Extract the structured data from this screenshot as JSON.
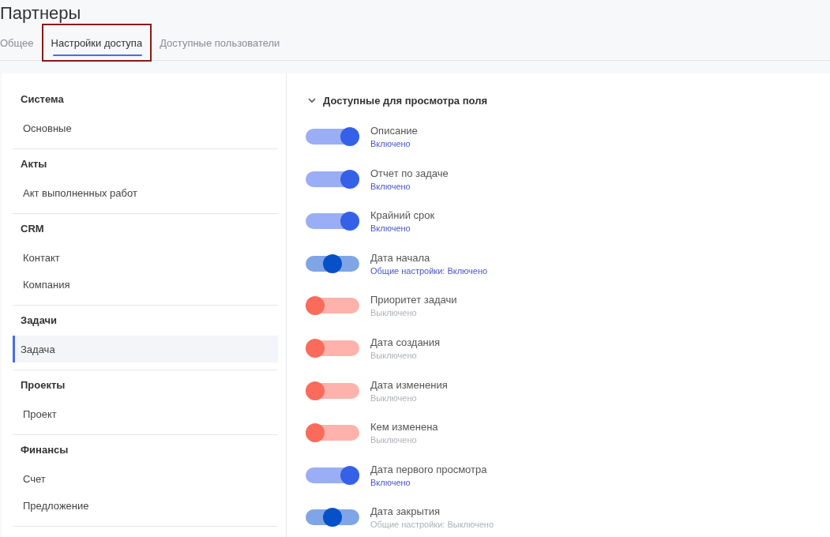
{
  "page": {
    "title": "Партнеры"
  },
  "tabs": [
    {
      "label": "Общее",
      "selected": false,
      "highlighted": false
    },
    {
      "label": "Настройки доступа",
      "selected": true,
      "highlighted": true
    },
    {
      "label": "Доступные пользователи",
      "selected": false,
      "highlighted": false
    }
  ],
  "sidebar": {
    "groups": [
      {
        "title": "Система",
        "items": [
          {
            "label": "Основные",
            "selected": false
          }
        ]
      },
      {
        "title": "Акты",
        "items": [
          {
            "label": "Акт выполненных работ",
            "selected": false
          }
        ]
      },
      {
        "title": "CRM",
        "items": [
          {
            "label": "Контакт",
            "selected": false
          },
          {
            "label": "Компания",
            "selected": false
          }
        ]
      },
      {
        "title": "Задачи",
        "items": [
          {
            "label": "Задача",
            "selected": true
          }
        ]
      },
      {
        "title": "Проекты",
        "items": [
          {
            "label": "Проект",
            "selected": false
          }
        ]
      },
      {
        "title": "Финансы",
        "items": [
          {
            "label": "Счет",
            "selected": false
          },
          {
            "label": "Предложение",
            "selected": false
          }
        ]
      }
    ]
  },
  "section": {
    "title": "Доступные для просмотра поля",
    "expanded": true,
    "fields": [
      {
        "label": "Описание",
        "kind": "on",
        "status": "Включено",
        "enabled": true
      },
      {
        "label": "Отчет по задаче",
        "kind": "on",
        "status": "Включено",
        "enabled": true
      },
      {
        "label": "Крайний срок",
        "kind": "on",
        "status": "Включено",
        "enabled": true
      },
      {
        "label": "Дата начала",
        "kind": "inherit",
        "status": "Общие настройки: Включено",
        "enabled": true
      },
      {
        "label": "Приоритет задачи",
        "kind": "off",
        "status": "Выключено",
        "enabled": false
      },
      {
        "label": "Дата создания",
        "kind": "off",
        "status": "Выключено",
        "enabled": false
      },
      {
        "label": "Дата изменения",
        "kind": "off",
        "status": "Выключено",
        "enabled": false
      },
      {
        "label": "Кем изменена",
        "kind": "off",
        "status": "Выключено",
        "enabled": false
      },
      {
        "label": "Дата первого просмотра",
        "kind": "on",
        "status": "Включено",
        "enabled": true
      },
      {
        "label": "Дата закрытия",
        "kind": "inherit",
        "status": "Общие настройки: Выключено",
        "enabled": false
      }
    ]
  }
}
